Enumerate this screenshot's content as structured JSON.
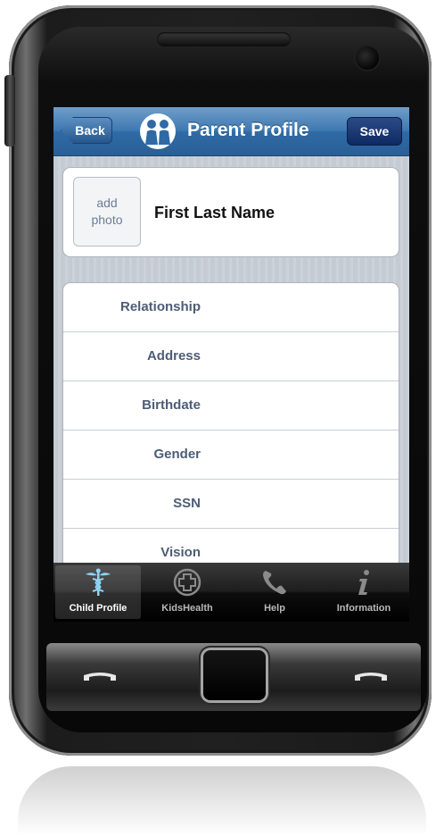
{
  "navbar": {
    "back_label": "Back",
    "title": "Parent Profile",
    "save_label": "Save",
    "logo_icon": "parent-child-logo-icon"
  },
  "profile": {
    "photo_line1": "add",
    "photo_line2": "photo",
    "name": "First Last Name"
  },
  "fields": [
    {
      "label": "Relationship"
    },
    {
      "label": "Address"
    },
    {
      "label": "Birthdate"
    },
    {
      "label": "Gender"
    },
    {
      "label": "SSN"
    },
    {
      "label": "Vision"
    }
  ],
  "tabs": [
    {
      "label": "Child Profile",
      "icon": "caduceus-icon",
      "active": true
    },
    {
      "label": "KidsHealth",
      "icon": "medical-cross-icon",
      "active": false
    },
    {
      "label": "Help",
      "icon": "phone-icon",
      "active": false
    },
    {
      "label": "Information",
      "icon": "info-icon",
      "active": false
    }
  ],
  "colors": {
    "navbar_blue": "#3f79b2",
    "save_navy": "#0e2a63",
    "label_slate": "#4d5d76"
  }
}
